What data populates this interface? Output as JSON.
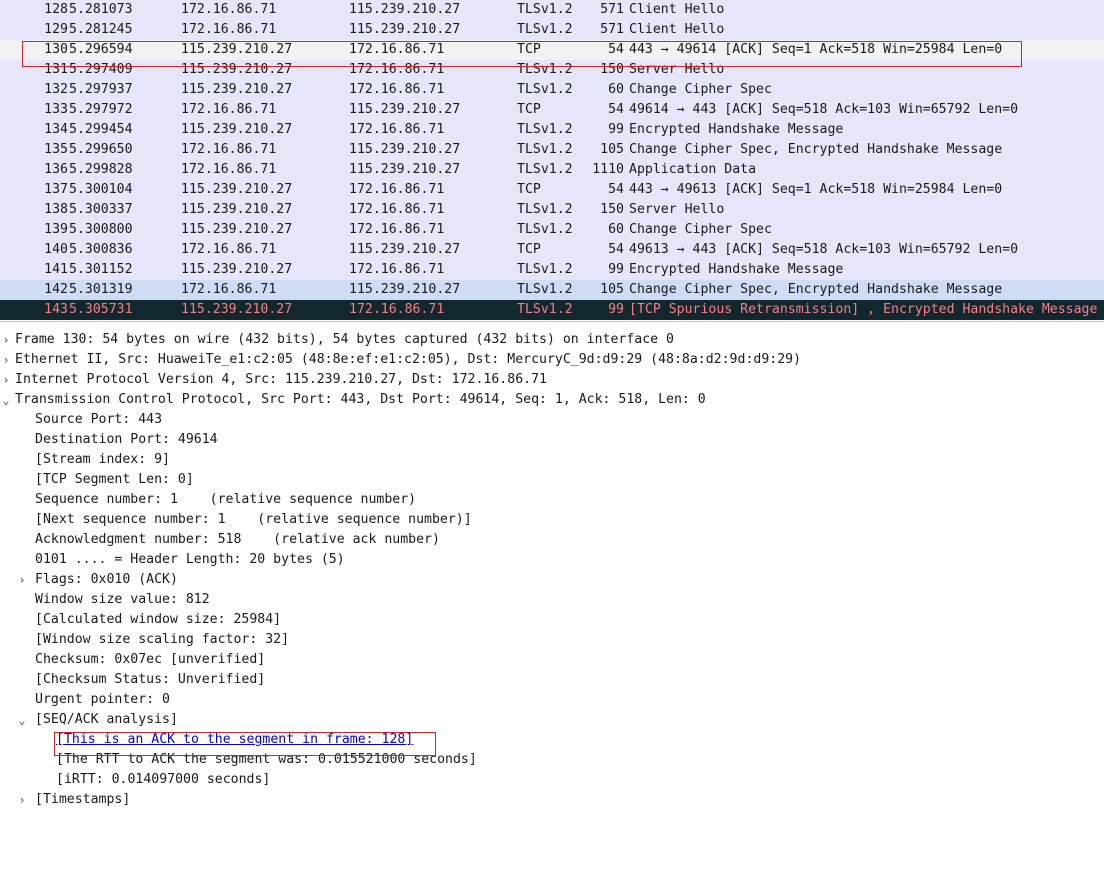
{
  "packet_list": {
    "rows": [
      {
        "no": "128",
        "time": "5.281073",
        "src": "172.16.86.71",
        "dst": "115.239.210.27",
        "proto": "TLSv1.2",
        "len": "571",
        "info": "Client Hello",
        "state": "tls"
      },
      {
        "no": "129",
        "time": "5.281245",
        "src": "172.16.86.71",
        "dst": "115.239.210.27",
        "proto": "TLSv1.2",
        "len": "571",
        "info": "Client Hello",
        "state": "tls"
      },
      {
        "no": "130",
        "time": "5.296594",
        "src": "115.239.210.27",
        "dst": "172.16.86.71",
        "proto": "TCP",
        "len": "54",
        "info": "443 → 49614 [ACK] Seq=1 Ack=518 Win=25984 Len=0",
        "state": "selected-tcp"
      },
      {
        "no": "131",
        "time": "5.297409",
        "src": "115.239.210.27",
        "dst": "172.16.86.71",
        "proto": "TLSv1.2",
        "len": "150",
        "info": "Server Hello",
        "state": "tls"
      },
      {
        "no": "132",
        "time": "5.297937",
        "src": "115.239.210.27",
        "dst": "172.16.86.71",
        "proto": "TLSv1.2",
        "len": "60",
        "info": "Change Cipher Spec",
        "state": "tls"
      },
      {
        "no": "133",
        "time": "5.297972",
        "src": "172.16.86.71",
        "dst": "115.239.210.27",
        "proto": "TCP",
        "len": "54",
        "info": "49614 → 443 [ACK] Seq=518 Ack=103 Win=65792 Len=0",
        "state": "tcp"
      },
      {
        "no": "134",
        "time": "5.299454",
        "src": "115.239.210.27",
        "dst": "172.16.86.71",
        "proto": "TLSv1.2",
        "len": "99",
        "info": "Encrypted Handshake Message",
        "state": "tls"
      },
      {
        "no": "135",
        "time": "5.299650",
        "src": "172.16.86.71",
        "dst": "115.239.210.27",
        "proto": "TLSv1.2",
        "len": "105",
        "info": "Change Cipher Spec, Encrypted Handshake Message",
        "state": "tls"
      },
      {
        "no": "136",
        "time": "5.299828",
        "src": "172.16.86.71",
        "dst": "115.239.210.27",
        "proto": "TLSv1.2",
        "len": "1110",
        "info": "Application Data",
        "state": "tls"
      },
      {
        "no": "137",
        "time": "5.300104",
        "src": "115.239.210.27",
        "dst": "172.16.86.71",
        "proto": "TCP",
        "len": "54",
        "info": "443 → 49613 [ACK] Seq=1 Ack=518 Win=25984 Len=0",
        "state": "tcp"
      },
      {
        "no": "138",
        "time": "5.300337",
        "src": "115.239.210.27",
        "dst": "172.16.86.71",
        "proto": "TLSv1.2",
        "len": "150",
        "info": "Server Hello",
        "state": "tls"
      },
      {
        "no": "139",
        "time": "5.300800",
        "src": "115.239.210.27",
        "dst": "172.16.86.71",
        "proto": "TLSv1.2",
        "len": "60",
        "info": "Change Cipher Spec",
        "state": "tls"
      },
      {
        "no": "140",
        "time": "5.300836",
        "src": "172.16.86.71",
        "dst": "115.239.210.27",
        "proto": "TCP",
        "len": "54",
        "info": "49613 → 443 [ACK] Seq=518 Ack=103 Win=65792 Len=0",
        "state": "tcp"
      },
      {
        "no": "141",
        "time": "5.301152",
        "src": "115.239.210.27",
        "dst": "172.16.86.71",
        "proto": "TLSv1.2",
        "len": "99",
        "info": "Encrypted Handshake Message",
        "state": "tls"
      },
      {
        "no": "142",
        "time": "5.301319",
        "src": "172.16.86.71",
        "dst": "115.239.210.27",
        "proto": "TLSv1.2",
        "len": "105",
        "info": "Change Cipher Spec, Encrypted Handshake Message",
        "state": "hl"
      },
      {
        "no": "143",
        "time": "5.305731",
        "src": "115.239.210.27",
        "dst": "172.16.86.71",
        "proto": "TLSv1.2",
        "len": "99",
        "info": "[TCP Spurious Retransmission] , Encrypted Handshake Message",
        "state": "spurious"
      }
    ]
  },
  "details": {
    "frame": "Frame 130: 54 bytes on wire (432 bits), 54 bytes captured (432 bits) on interface 0",
    "ethernet": "Ethernet II, Src: HuaweiTe_e1:c2:05 (48:8e:ef:e1:c2:05), Dst: MercuryC_9d:d9:29 (48:8a:d2:9d:d9:29)",
    "ip": "Internet Protocol Version 4, Src: 115.239.210.27, Dst: 172.16.86.71",
    "tcp": "Transmission Control Protocol, Src Port: 443, Dst Port: 49614, Seq: 1, Ack: 518, Len: 0",
    "source_port": "Source Port: 443",
    "destination_port": "Destination Port: 49614",
    "stream_index": "[Stream index: 9]",
    "segment_len": "[TCP Segment Len: 0]",
    "sequence_number": "Sequence number: 1    (relative sequence number)",
    "next_sequence_number": "[Next sequence number: 1    (relative sequence number)]",
    "ack_number": "Acknowledgment number: 518    (relative ack number)",
    "header_length": "0101 .... = Header Length: 20 bytes (5)",
    "flags": "Flags: 0x010 (ACK)",
    "window_size": "Window size value: 812",
    "calculated_window": "[Calculated window size: 25984]",
    "scaling_factor": "[Window size scaling factor: 32]",
    "checksum": "Checksum: 0x07ec [unverified]",
    "checksum_status": "[Checksum Status: Unverified]",
    "urgent_pointer": "Urgent pointer: 0",
    "seq_ack_analysis": "[SEQ/ACK analysis]",
    "ack_to_frame": "[This is an ACK to the segment in frame: 128]",
    "rtt": "[The RTT to ACK the segment was: 0.015521000 seconds]",
    "irtt": "[iRTT: 0.014097000 seconds]",
    "timestamps": "[Timestamps]"
  },
  "icons": {
    "collapsed": "chevron-right-icon",
    "expanded": "chevron-down-icon"
  },
  "colors": {
    "tls_row": "#e6e6fa",
    "spurious_row_bg": "#12272e",
    "spurious_row_fg": "#f78087",
    "annotation_box": "#e02020"
  }
}
